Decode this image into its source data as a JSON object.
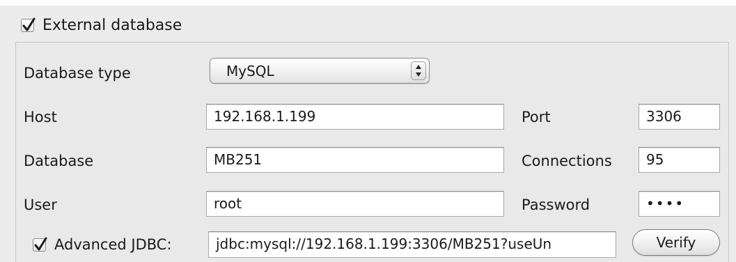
{
  "external_database": {
    "label": "External database",
    "checked": true
  },
  "database_type": {
    "label": "Database type",
    "value": "MySQL"
  },
  "host": {
    "label": "Host",
    "value": "192.168.1.199"
  },
  "port": {
    "label": "Port",
    "value": "3306"
  },
  "database": {
    "label": "Database",
    "value": "MB251"
  },
  "connections": {
    "label": "Connections",
    "value": "95"
  },
  "user": {
    "label": "User",
    "value": "root"
  },
  "password": {
    "label": "Password",
    "masked": "••••"
  },
  "advanced_jdbc": {
    "label": "Advanced JDBC:",
    "checked": true,
    "value": "jdbc:mysql://192.168.1.199:3306/MB251?useUn"
  },
  "verify_button": {
    "label": "Verify"
  }
}
